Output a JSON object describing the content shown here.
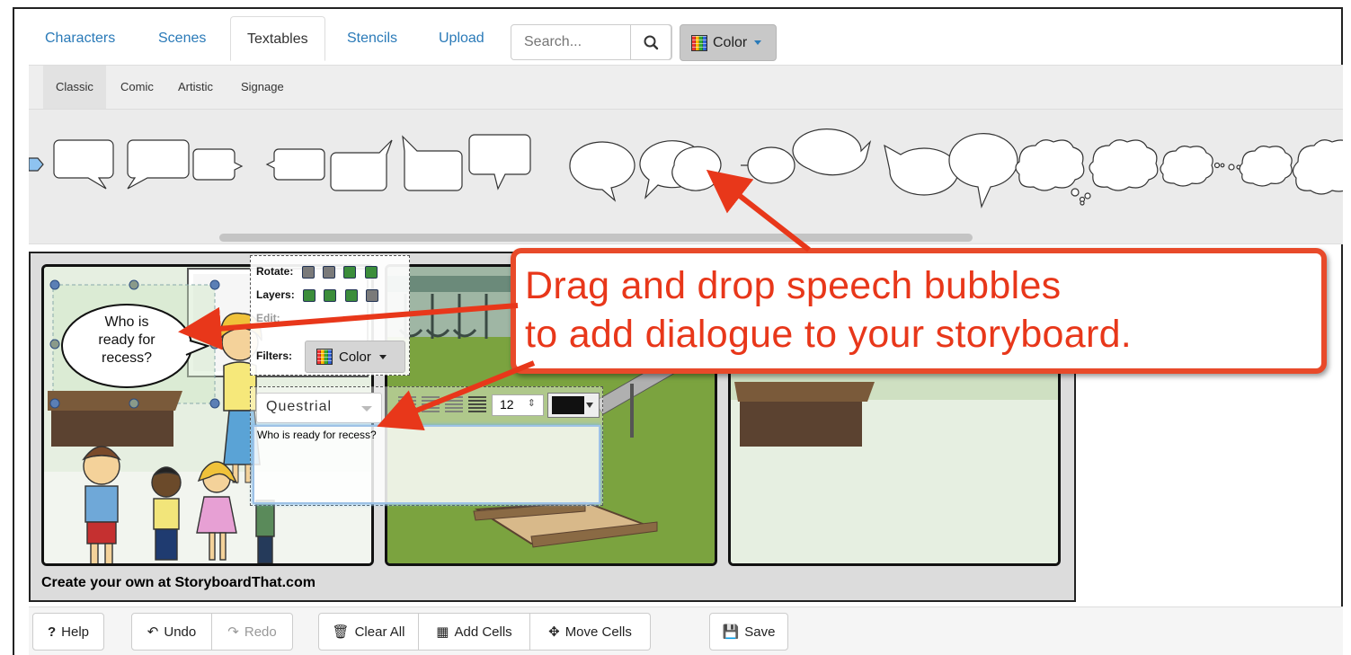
{
  "tabs": [
    {
      "label": "Characters",
      "active": false
    },
    {
      "label": "Scenes",
      "active": false
    },
    {
      "label": "Textables",
      "active": true
    },
    {
      "label": "Stencils",
      "active": false
    },
    {
      "label": "Upload",
      "active": false
    }
  ],
  "search": {
    "placeholder": "Search..."
  },
  "color_button": {
    "label": "Color"
  },
  "subtabs": [
    {
      "label": "Classic",
      "active": true
    },
    {
      "label": "Comic",
      "active": false
    },
    {
      "label": "Artistic",
      "active": false
    },
    {
      "label": "Signage",
      "active": false
    }
  ],
  "object_toolbar": {
    "rotate_label": "Rotate:",
    "layers_label": "Layers:",
    "edit_label": "Edit:",
    "filters_label": "Filters:",
    "filter_color_label": "Color"
  },
  "text_editor": {
    "font": "Questrial",
    "size": "12",
    "text": "Who is ready for recess?"
  },
  "speech_bubble": {
    "line1": "Who is",
    "line2": "ready for",
    "line3": "recess?"
  },
  "watermark": "Create your own at StoryboardThat.com",
  "callout": {
    "line1": "Drag and drop speech bubbles",
    "line2": "to add dialogue to your storyboard."
  },
  "bottom_toolbar": {
    "help": "Help",
    "undo": "Undo",
    "redo": "Redo",
    "clear_all": "Clear All",
    "add_cells": "Add Cells",
    "move_cells": "Move Cells",
    "save": "Save"
  },
  "colors": {
    "link": "#2a7ab8",
    "callout": "#e8371a",
    "cell_bg": "#e8f0e3"
  }
}
